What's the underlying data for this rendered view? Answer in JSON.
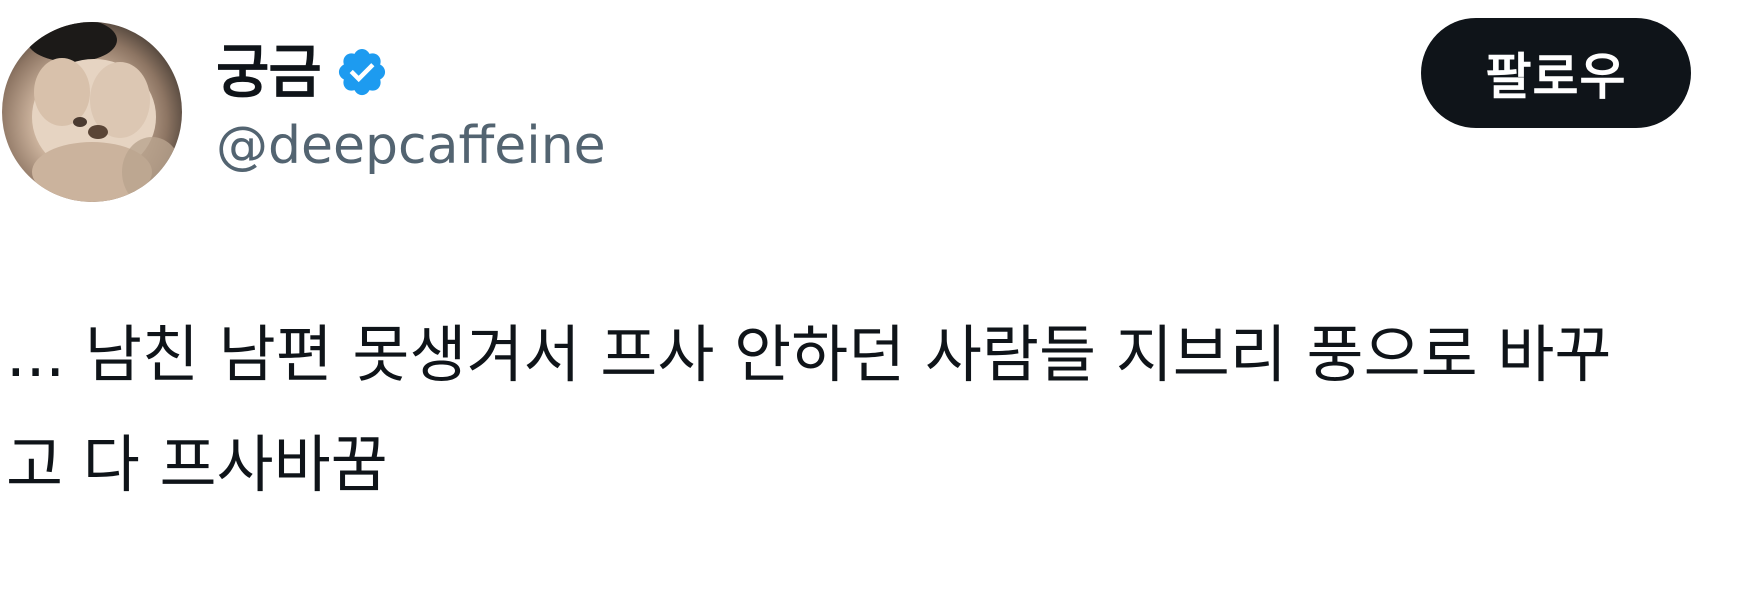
{
  "author": {
    "display_name": "궁금",
    "handle": "@deepcaffeine",
    "verified": true,
    "avatar_icon": "dog-avatar"
  },
  "actions": {
    "follow_label": "팔로우"
  },
  "tweet": {
    "text_line1": "... 남친 남편 못생겨서 프사 안하던 사람들 지브리 풍으로 바꾸",
    "text_line2": "고 다 프사바꿈"
  },
  "colors": {
    "text_primary": "#0f1419",
    "text_secondary": "#536471",
    "verified_blue": "#1d9bf0",
    "button_bg": "#0f1419",
    "button_text": "#ffffff"
  }
}
